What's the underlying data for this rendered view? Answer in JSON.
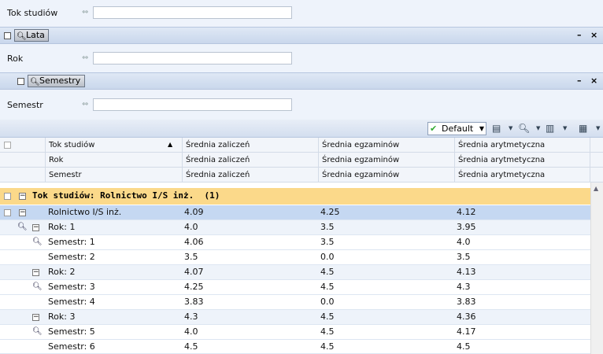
{
  "filters": {
    "tok": {
      "label": "Tok studiów",
      "arrow": "⇔",
      "value": ""
    },
    "rok": {
      "label": "Rok",
      "arrow": "⇔",
      "value": ""
    },
    "semestr": {
      "label": "Semestr",
      "arrow": "⇔",
      "value": ""
    }
  },
  "panels": {
    "lata": {
      "button": "Lata",
      "minimize": "–",
      "close": "×"
    },
    "semestry": {
      "button": "Semestry",
      "minimize": "–",
      "close": "×"
    }
  },
  "toolbar": {
    "view_label": "Default"
  },
  "headers": [
    [
      "Tok studiów",
      "Średnia zaliczeń",
      "Średnia egzaminów",
      "Średnia arytmetyczna"
    ],
    [
      "Rok",
      "Średnia zaliczeń",
      "Średnia egzaminów",
      "Średnia arytmetyczna"
    ],
    [
      "Semestr",
      "Średnia zaliczeń",
      "Średnia egzaminów",
      "Średnia arytmetyczna"
    ]
  ],
  "group": {
    "label": "Tok studiów: Rolnictwo I/S inż.  (1)"
  },
  "rows": [
    {
      "name": "Rolnictwo I/S inż.",
      "z": "4.09",
      "e": "4.25",
      "a": "4.12"
    },
    {
      "name": "Rok: 1",
      "z": "4.0",
      "e": "3.5",
      "a": "3.95"
    },
    {
      "name": "Semestr: 1",
      "z": "4.06",
      "e": "3.5",
      "a": "4.0"
    },
    {
      "name": "Semestr: 2",
      "z": "3.5",
      "e": "0.0",
      "a": "3.5"
    },
    {
      "name": "Rok: 2",
      "z": "4.07",
      "e": "4.5",
      "a": "4.13"
    },
    {
      "name": "Semestr: 3",
      "z": "4.25",
      "e": "4.5",
      "a": "4.3"
    },
    {
      "name": "Semestr: 4",
      "z": "3.83",
      "e": "0.0",
      "a": "3.83"
    },
    {
      "name": "Rok: 3",
      "z": "4.3",
      "e": "4.5",
      "a": "4.36"
    },
    {
      "name": "Semestr: 5",
      "z": "4.0",
      "e": "4.5",
      "a": "4.17"
    },
    {
      "name": "Semestr: 6",
      "z": "4.5",
      "e": "4.5",
      "a": "4.5"
    }
  ]
}
